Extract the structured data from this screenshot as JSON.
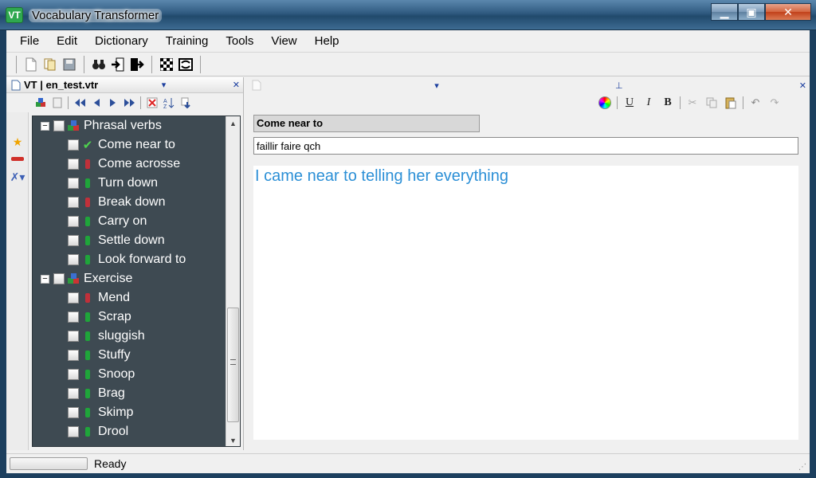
{
  "window": {
    "icon_text": "VT",
    "title": "Vocabulary Transformer",
    "minimize": "▁",
    "maximize": "▣",
    "close": "✕"
  },
  "menu": [
    "File",
    "Edit",
    "Dictionary",
    "Training",
    "Tools",
    "View",
    "Help"
  ],
  "toolbar_icons": [
    "new-file-icon",
    "open-icon",
    "save-icon",
    "binoculars-icon",
    "import-icon",
    "export-icon",
    "checker-icon",
    "test-icon"
  ],
  "left_panel": {
    "title": "VT | en_test.vtr",
    "pin_glyph": "▾",
    "close_glyph": "✕"
  },
  "tree": {
    "groups": [
      {
        "label": "Phrasal verbs",
        "items": [
          {
            "label": "Come near to",
            "status": "check"
          },
          {
            "label": "Come acrosse",
            "status": "red"
          },
          {
            "label": "Turn down",
            "status": "green"
          },
          {
            "label": "Break down",
            "status": "red"
          },
          {
            "label": "Carry on",
            "status": "green"
          },
          {
            "label": "Settle down",
            "status": "green"
          },
          {
            "label": "Look forward to",
            "status": "green"
          }
        ]
      },
      {
        "label": "Exercise",
        "items": [
          {
            "label": "Mend",
            "status": "red"
          },
          {
            "label": "Scrap",
            "status": "green"
          },
          {
            "label": "sluggish",
            "status": "green"
          },
          {
            "label": "Stuffy",
            "status": "green"
          },
          {
            "label": "Snoop",
            "status": "green"
          },
          {
            "label": "Brag",
            "status": "green"
          },
          {
            "label": "Skimp",
            "status": "green"
          },
          {
            "label": "Drool",
            "status": "green"
          }
        ]
      }
    ]
  },
  "editor": {
    "word": "Come near to",
    "translation": "faillir faire qch",
    "example": "I came near to telling her everything",
    "example_color": "#2b8fd6"
  },
  "status": {
    "text": "Ready"
  }
}
